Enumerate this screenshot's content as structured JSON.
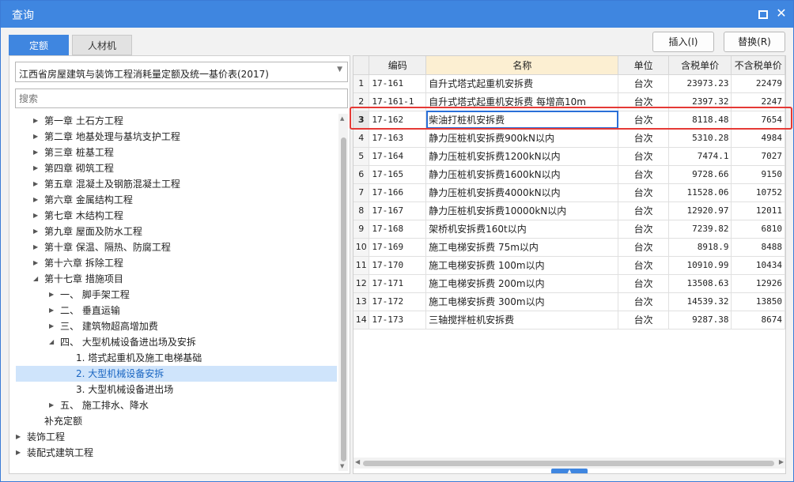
{
  "window": {
    "title": "查询"
  },
  "tabs": {
    "quota": "定额",
    "material": "人材机"
  },
  "buttons": {
    "insert": "插入(I)",
    "replace": "替换(R)"
  },
  "left": {
    "selector_value": "江西省房屋建筑与装饰工程消耗量定额及统一基价表(2017)",
    "search_placeholder": "搜索",
    "tree": [
      {
        "label": "第一章 土石方工程",
        "toggle": "▶"
      },
      {
        "label": "第二章 地基处理与基坑支护工程",
        "toggle": "▶"
      },
      {
        "label": "第三章 桩基工程",
        "toggle": "▶"
      },
      {
        "label": "第四章 砌筑工程",
        "toggle": "▶"
      },
      {
        "label": "第五章 混凝土及钢筋混凝土工程",
        "toggle": "▶"
      },
      {
        "label": "第六章 金属结构工程",
        "toggle": "▶"
      },
      {
        "label": "第七章 木结构工程",
        "toggle": "▶"
      },
      {
        "label": "第九章 屋面及防水工程",
        "toggle": "▶"
      },
      {
        "label": "第十章 保温、隔热、防腐工程",
        "toggle": "▶"
      },
      {
        "label": "第十六章 拆除工程",
        "toggle": "▶"
      },
      {
        "label": "第十七章 措施项目",
        "toggle": "◢"
      },
      {
        "label": "一、 脚手架工程",
        "toggle": "▶"
      },
      {
        "label": "二、 垂直运输",
        "toggle": "▶"
      },
      {
        "label": "三、 建筑物超高增加费",
        "toggle": "▶"
      },
      {
        "label": "四、 大型机械设备进出场及安拆",
        "toggle": "◢"
      },
      {
        "label": "1. 塔式起重机及施工电梯基础",
        "toggle": ""
      },
      {
        "label": "2. 大型机械设备安拆",
        "toggle": ""
      },
      {
        "label": "3. 大型机械设备进出场",
        "toggle": ""
      },
      {
        "label": "五、 施工排水、降水",
        "toggle": "▶"
      },
      {
        "label": "补充定额",
        "toggle": ""
      },
      {
        "label": "装饰工程",
        "toggle": "▶"
      },
      {
        "label": "装配式建筑工程",
        "toggle": "▶"
      }
    ]
  },
  "grid": {
    "headers": {
      "code": "编码",
      "name": "名称",
      "unit": "单位",
      "tax_price": "含税单价",
      "notax_price": "不含税单价"
    },
    "rows": [
      {
        "idx": "1",
        "code": "17-161",
        "name": "自升式塔式起重机安拆费",
        "unit": "台次",
        "tax": "23973.23",
        "notax": "22479"
      },
      {
        "idx": "2",
        "code": "17-161-1",
        "name": "自升式塔式起重机安拆费 每增高10m",
        "unit": "台次",
        "tax": "2397.32",
        "notax": "2247"
      },
      {
        "idx": "3",
        "code": "17-162",
        "name": "柴油打桩机安拆费",
        "unit": "台次",
        "tax": "8118.48",
        "notax": "7654"
      },
      {
        "idx": "4",
        "code": "17-163",
        "name": "静力压桩机安拆费900kN以内",
        "unit": "台次",
        "tax": "5310.28",
        "notax": "4984"
      },
      {
        "idx": "5",
        "code": "17-164",
        "name": "静力压桩机安拆费1200kN以内",
        "unit": "台次",
        "tax": "7474.1",
        "notax": "7027"
      },
      {
        "idx": "6",
        "code": "17-165",
        "name": "静力压桩机安拆费1600kN以内",
        "unit": "台次",
        "tax": "9728.66",
        "notax": "9150"
      },
      {
        "idx": "7",
        "code": "17-166",
        "name": "静力压桩机安拆费4000kN以内",
        "unit": "台次",
        "tax": "11528.06",
        "notax": "10752"
      },
      {
        "idx": "8",
        "code": "17-167",
        "name": "静力压桩机安拆费10000kN以内",
        "unit": "台次",
        "tax": "12920.97",
        "notax": "12011"
      },
      {
        "idx": "9",
        "code": "17-168",
        "name": "架桥机安拆费160t以内",
        "unit": "台次",
        "tax": "7239.82",
        "notax": "6810"
      },
      {
        "idx": "10",
        "code": "17-169",
        "name": "施工电梯安拆费 75m以内",
        "unit": "台次",
        "tax": "8918.9",
        "notax": "8488"
      },
      {
        "idx": "11",
        "code": "17-170",
        "name": "施工电梯安拆费 100m以内",
        "unit": "台次",
        "tax": "10910.99",
        "notax": "10434"
      },
      {
        "idx": "12",
        "code": "17-171",
        "name": "施工电梯安拆费 200m以内",
        "unit": "台次",
        "tax": "13508.63",
        "notax": "12926"
      },
      {
        "idx": "13",
        "code": "17-172",
        "name": "施工电梯安拆费 300m以内",
        "unit": "台次",
        "tax": "14539.32",
        "notax": "13850"
      },
      {
        "idx": "14",
        "code": "17-173",
        "name": "三轴搅拌桩机安拆费",
        "unit": "台次",
        "tax": "9287.38",
        "notax": "8674"
      }
    ]
  },
  "colors": {
    "accent": "#3f86e0",
    "highlight": "#e53935",
    "selected_tree_bg": "#cfe4fb",
    "name_header_bg": "#fcefd2"
  }
}
